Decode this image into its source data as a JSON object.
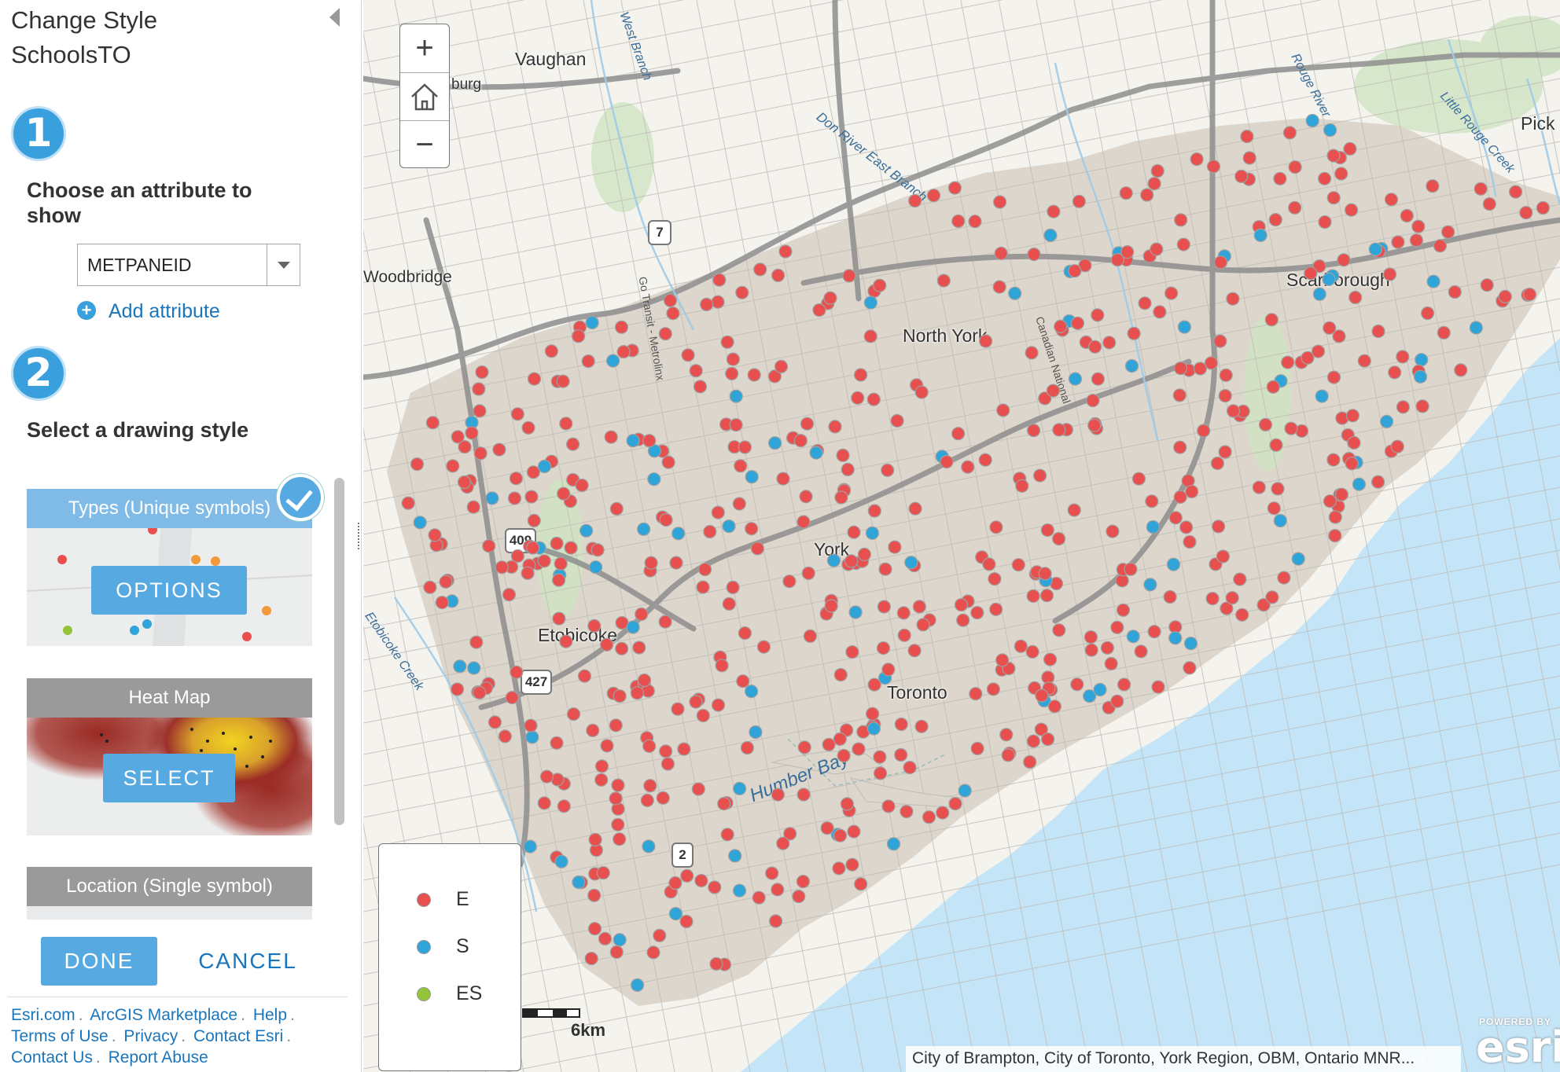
{
  "panel": {
    "title": "Change Style",
    "layer_name": "SchoolsTO",
    "step1": {
      "number": "1",
      "label": "Choose an attribute to show"
    },
    "attribute_select": {
      "value": "METPANEID"
    },
    "add_attribute": "Add attribute",
    "step2": {
      "number": "2",
      "label": "Select a drawing style"
    },
    "styles": [
      {
        "title": "Types (Unique symbols)",
        "button": "OPTIONS",
        "selected": true
      },
      {
        "title": "Heat Map",
        "button": "SELECT",
        "selected": false
      },
      {
        "title": "Location (Single symbol)",
        "button": "",
        "selected": false
      }
    ],
    "done": "DONE",
    "cancel": "CANCEL",
    "footer_links": [
      "Esri.com",
      "ArcGIS Marketplace",
      "Help",
      "Terms of Use",
      "Privacy",
      "Contact Esri",
      "Contact Us",
      "Report Abuse"
    ]
  },
  "map": {
    "places": [
      "Vaughan",
      "Woodbridge",
      "North York",
      "Scarborough",
      "York",
      "Etobicoke",
      "Toronto",
      "Pick",
      "burg"
    ],
    "water_labels": [
      "Humber Bay",
      "West Branch",
      "Don River East Branch",
      "Rouge River",
      "Little Rouge Creek",
      "Go Transit - Metrolinx",
      "Canadian National",
      "Etobicoke Creek"
    ],
    "highway_shields": [
      "7",
      "409",
      "427",
      "2"
    ],
    "legend": [
      {
        "label": "E",
        "color": "#e8504f"
      },
      {
        "label": "S",
        "color": "#2ea4d8"
      },
      {
        "label": "ES",
        "color": "#94c43a"
      }
    ],
    "scale_label": "6km",
    "attribution": "City of Brampton, City of Toronto, York Region, OBM, Ontario MNR...",
    "esri_logo": {
      "powered_by": "POWERED BY",
      "brand": "esri"
    },
    "zoom": {
      "in": "+",
      "out": "−"
    },
    "colors": {
      "E": "#e8504f",
      "S": "#2ea4d8",
      "ES": "#94c43a",
      "accent": "#57a9e1",
      "land": "#dcd6cc"
    }
  }
}
